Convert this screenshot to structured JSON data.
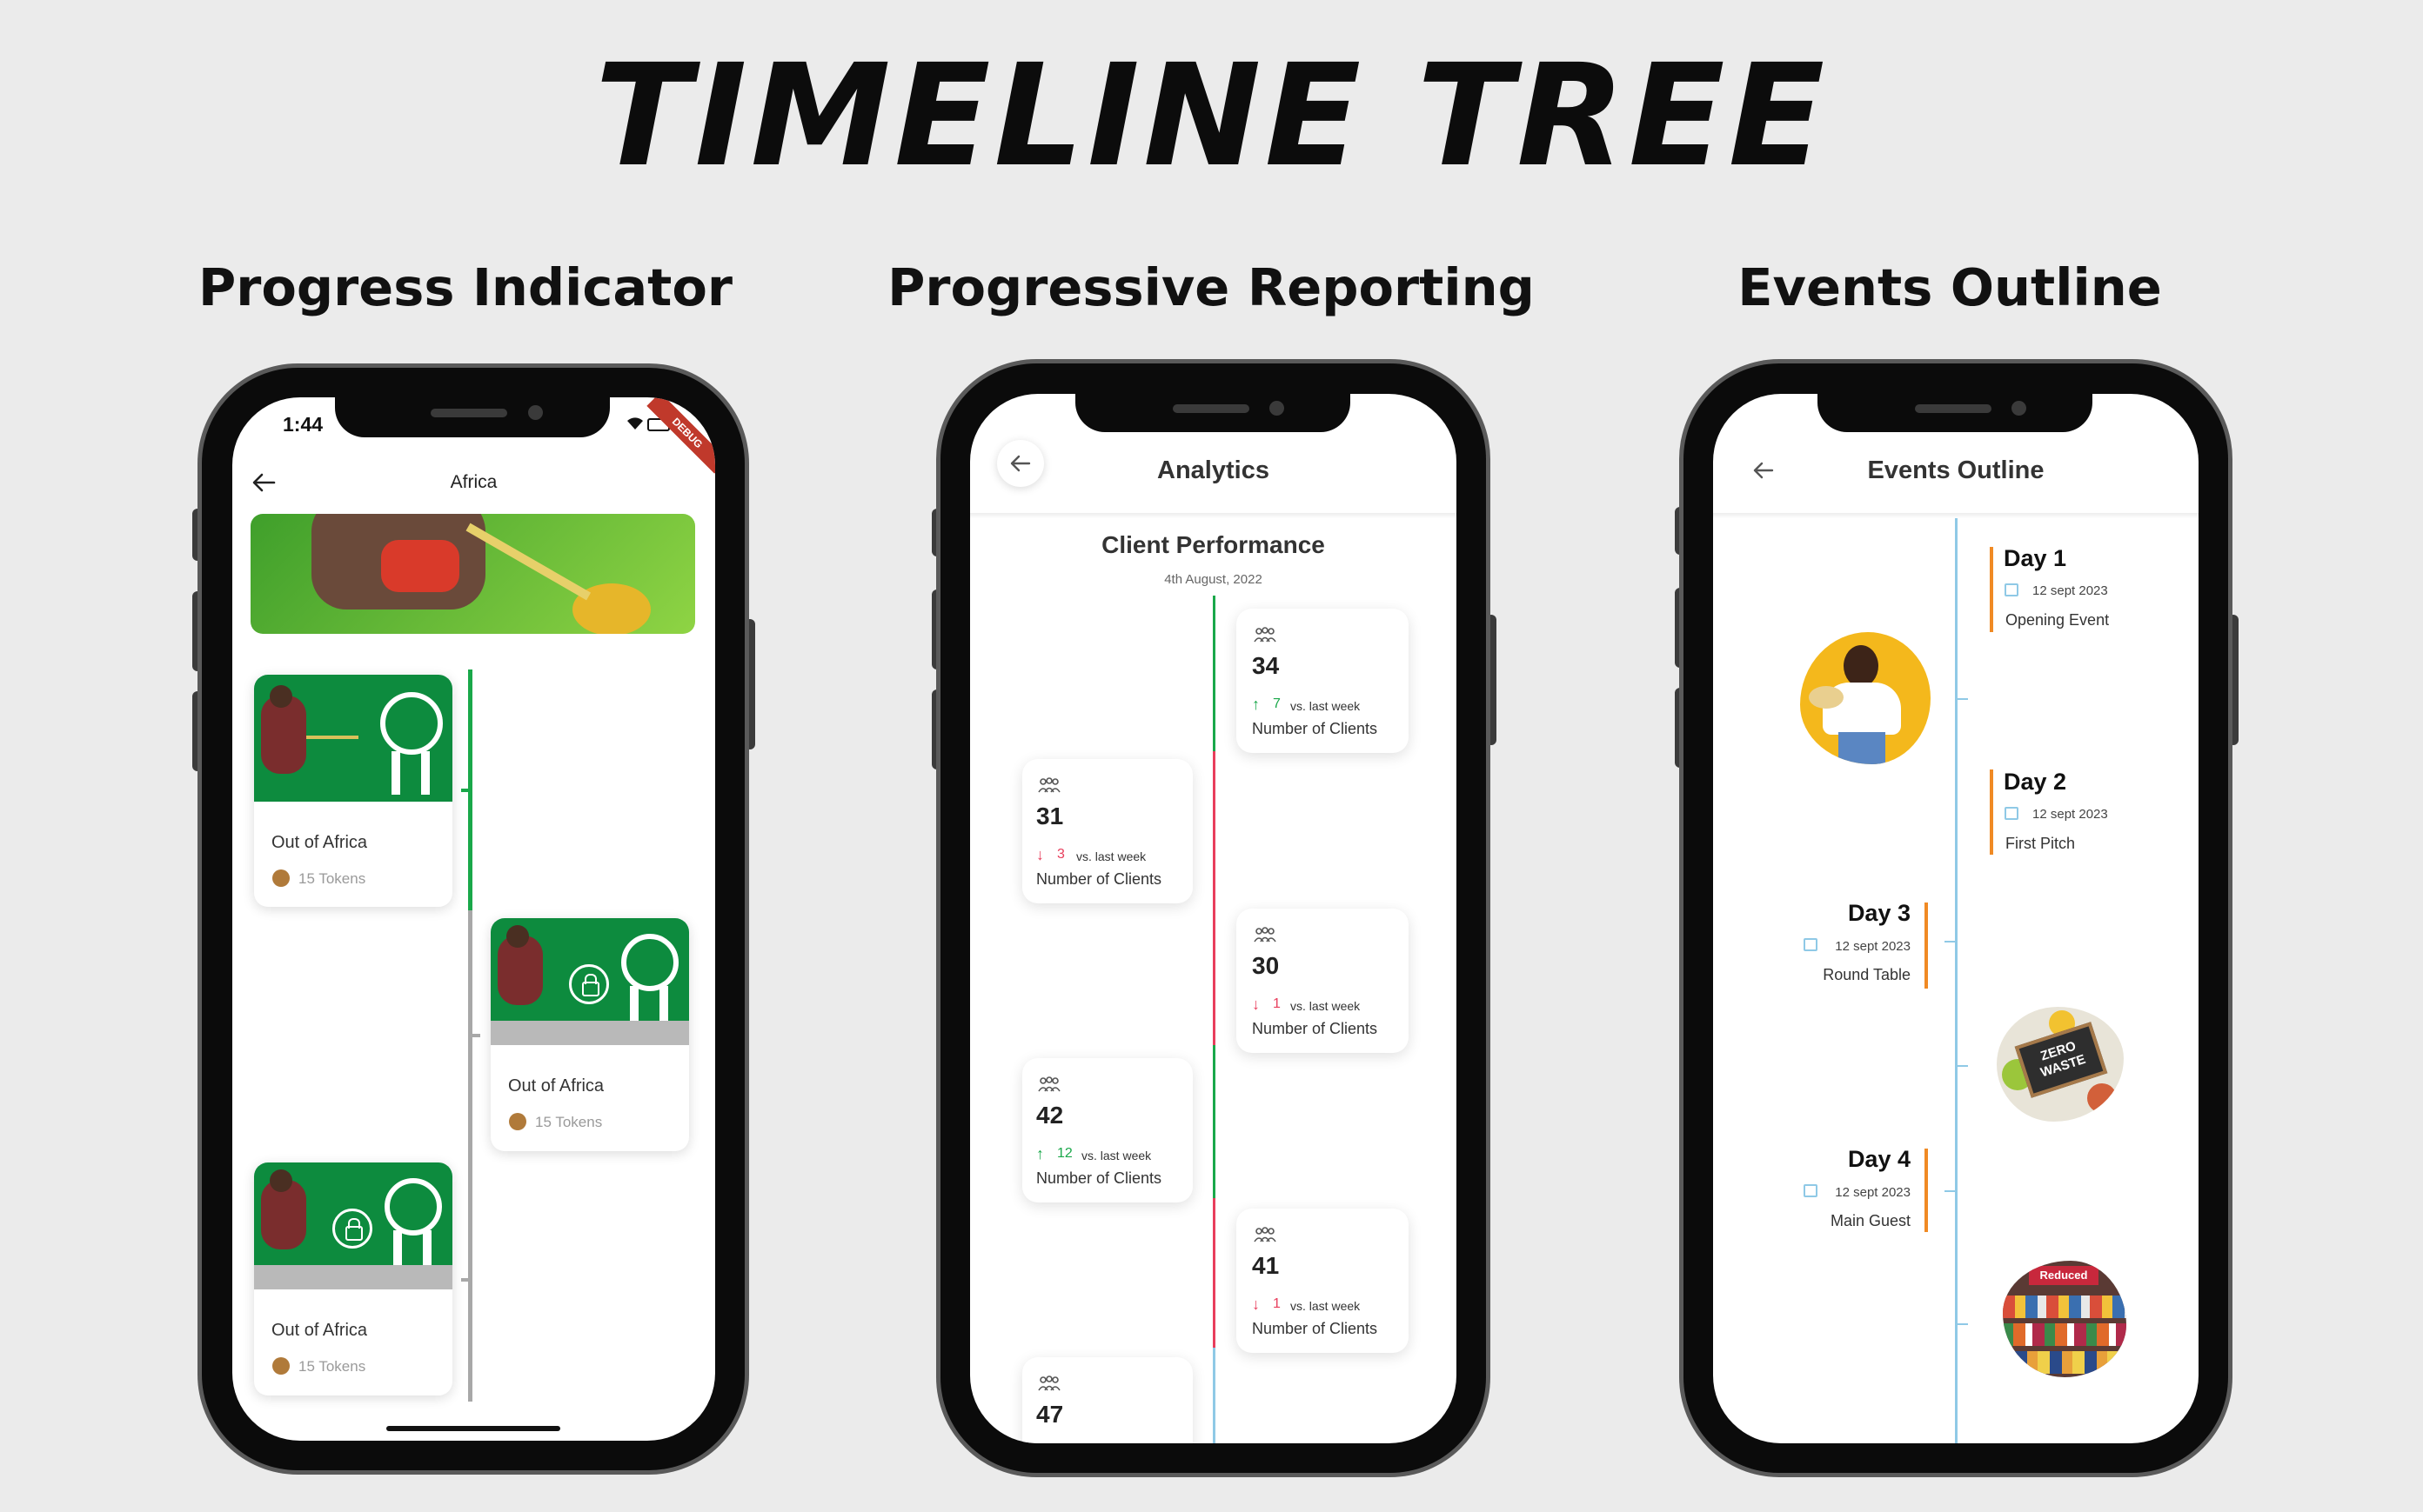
{
  "title": "TIMELINE TREE",
  "sections": {
    "progress": "Progress Indicator",
    "reporting": "Progressive Reporting",
    "events": "Events Outline"
  },
  "phone1": {
    "time": "1:44",
    "debug": "DEBUG",
    "title": "Africa",
    "cards": [
      {
        "name": "Out of Africa",
        "tokens": "15 Tokens",
        "locked": false
      },
      {
        "name": "Out of Africa",
        "tokens": "15 Tokens",
        "locked": true
      },
      {
        "name": "Out of Africa",
        "tokens": "15 Tokens",
        "locked": true
      }
    ]
  },
  "phone2": {
    "title": "Analytics",
    "heading": "Client Performance",
    "date": "4th August, 2022",
    "cards": [
      {
        "value": "34",
        "delta": "7",
        "trend": "up",
        "vs": "vs. last week",
        "label": "Number of Clients"
      },
      {
        "value": "31",
        "delta": "3",
        "trend": "down",
        "vs": "vs. last week",
        "label": "Number of Clients"
      },
      {
        "value": "30",
        "delta": "1",
        "trend": "down",
        "vs": "vs. last week",
        "label": "Number of Clients"
      },
      {
        "value": "42",
        "delta": "12",
        "trend": "up",
        "vs": "vs. last week",
        "label": "Number of Clients"
      },
      {
        "value": "41",
        "delta": "1",
        "trend": "down",
        "vs": "vs. last week",
        "label": "Number of Clients"
      },
      {
        "value": "47"
      }
    ]
  },
  "phone3": {
    "title": "Events Outline",
    "events": [
      {
        "day": "Day 1",
        "date": "12 sept 2023",
        "name": "Opening Event"
      },
      {
        "day": "Day 2",
        "date": "12 sept 2023",
        "name": "First Pitch"
      },
      {
        "day": "Day 3",
        "date": "12 sept 2023",
        "name": "Round Table"
      },
      {
        "day": "Day 4",
        "date": "12 sept 2023",
        "name": "Main Guest"
      }
    ],
    "image_texts": {
      "zero_waste": "ZERO WASTE",
      "reduced": "Reduced"
    }
  },
  "colors": {
    "green": "#1aa84a",
    "red": "#e83e5c",
    "orange": "#f08a24",
    "blue": "#8fc9e6",
    "gray": "#a8a8a8"
  }
}
